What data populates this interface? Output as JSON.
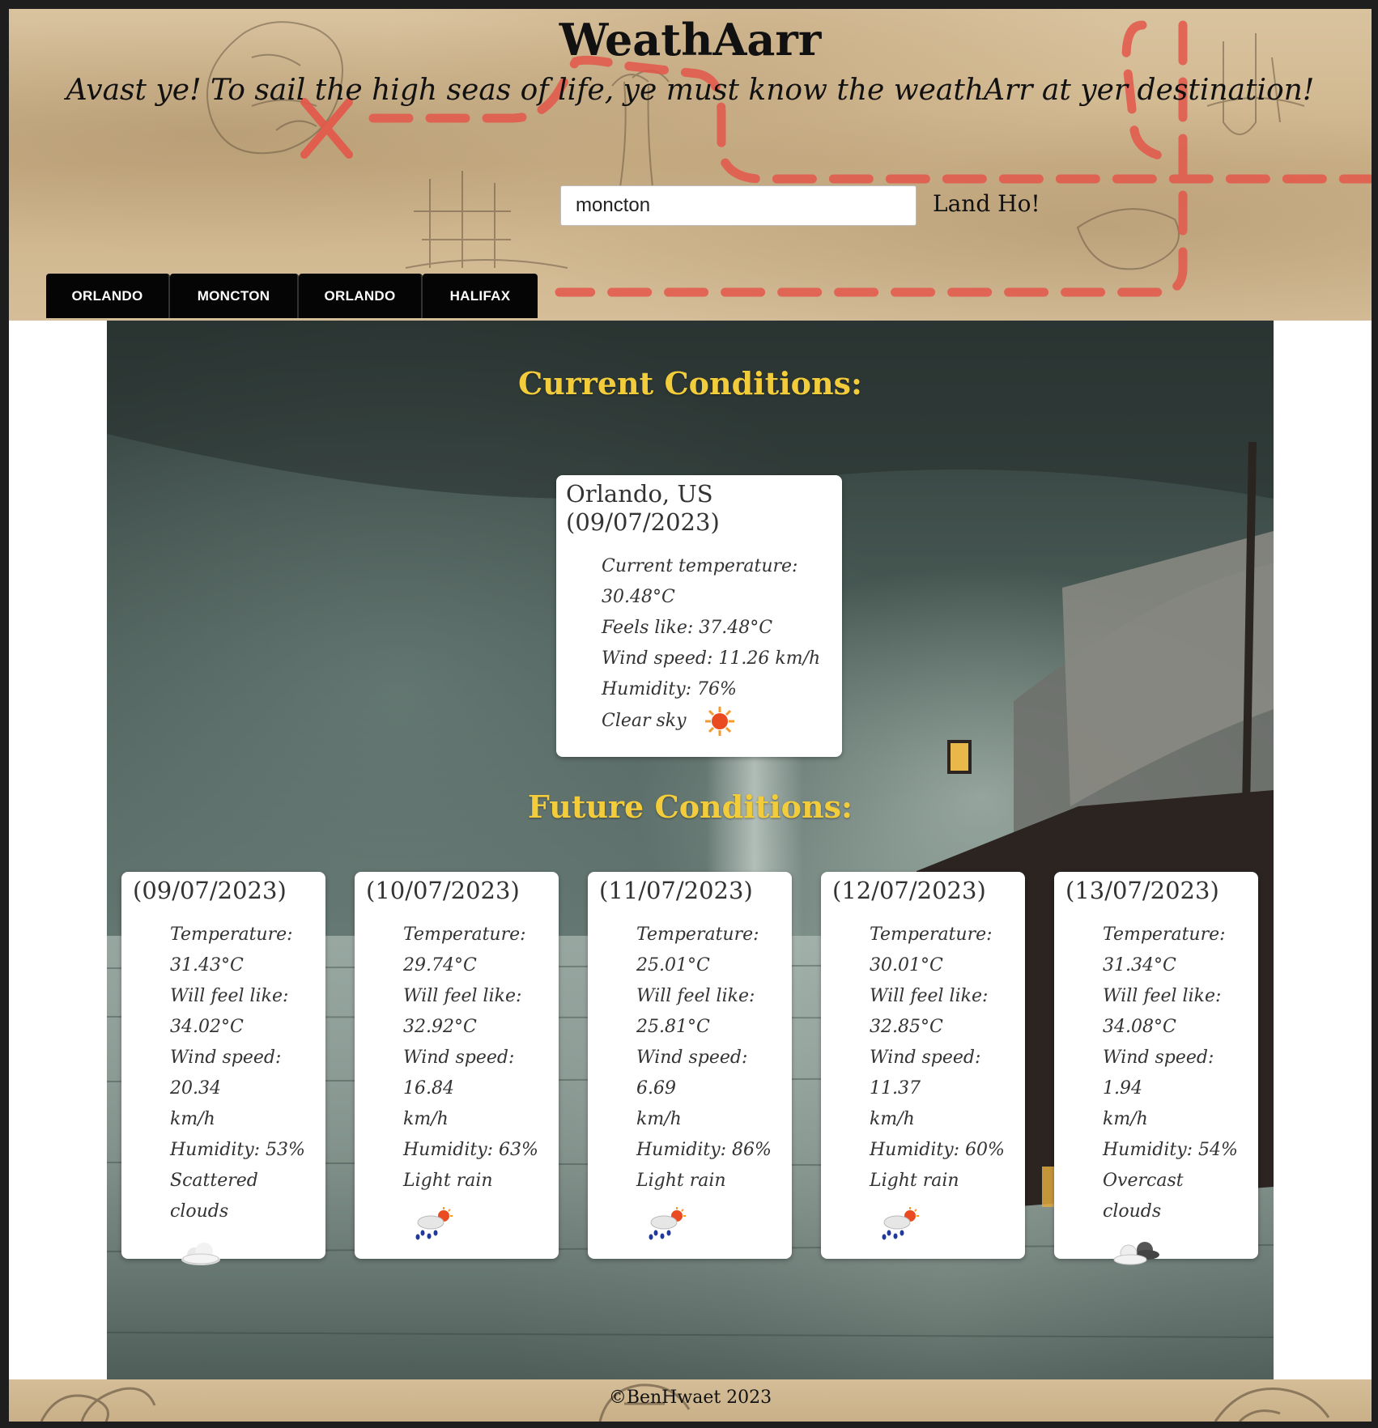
{
  "header": {
    "title": "WeathAarr",
    "tagline": "Avast ye! To sail the high seas of life, ye must know the weathArr at yer destination!",
    "search": {
      "value": "moncton",
      "button_label": "Land Ho!"
    },
    "history": [
      "ORLANDO",
      "MONCTON",
      "ORLANDO",
      "HALIFAX"
    ]
  },
  "current": {
    "heading": "Current Conditions:",
    "city": "Orlando, US",
    "date": "(09/07/2023)",
    "temperature": "Current temperature: 30.48°C",
    "feels_like": "Feels like: 37.48°C",
    "wind": "Wind speed: 11.26 km/h",
    "humidity": "Humidity: 76%",
    "description": "Clear sky",
    "icon": "sun-icon"
  },
  "future": {
    "heading": "Future Conditions:",
    "days": [
      {
        "date": "(09/07/2023)",
        "temp_label": "Temperature:",
        "temp": "31.43°C",
        "feels_label": "Will feel like:",
        "feels": "34.02°C",
        "wind": "Wind speed: 20.34",
        "wind_unit": "km/h",
        "humidity": "Humidity: 53%",
        "description": "Scattered clouds",
        "icon": "cloud-icon"
      },
      {
        "date": "(10/07/2023)",
        "temp_label": "Temperature:",
        "temp": "29.74°C",
        "feels_label": "Will feel like:",
        "feels": "32.92°C",
        "wind": "Wind speed: 16.84",
        "wind_unit": "km/h",
        "humidity": "Humidity: 63%",
        "description": "Light rain",
        "icon": "sun-rain-icon"
      },
      {
        "date": "(11/07/2023)",
        "temp_label": "Temperature:",
        "temp": "25.01°C",
        "feels_label": "Will feel like:",
        "feels": "25.81°C",
        "wind": "Wind speed: 6.69",
        "wind_unit": "km/h",
        "humidity": "Humidity: 86%",
        "description": "Light rain",
        "icon": "sun-rain-icon"
      },
      {
        "date": "(12/07/2023)",
        "temp_label": "Temperature:",
        "temp": "30.01°C",
        "feels_label": "Will feel like:",
        "feels": "32.85°C",
        "wind": "Wind speed: 11.37",
        "wind_unit": "km/h",
        "humidity": "Humidity: 60%",
        "description": "Light rain",
        "icon": "sun-rain-icon"
      },
      {
        "date": "(13/07/2023)",
        "temp_label": "Temperature:",
        "temp": "31.34°C",
        "feels_label": "Will feel like:",
        "feels": "34.08°C",
        "wind": "Wind speed: 1.94",
        "wind_unit": "km/h",
        "humidity": "Humidity: 54%",
        "description": "Overcast clouds",
        "icon": "overcast-icon"
      }
    ]
  },
  "footer": {
    "text": "©BenHwaet 2023"
  },
  "colors": {
    "heading_gold": "#f2cc3a",
    "map_path_red": "#e4574a",
    "tab_black": "#050505"
  }
}
